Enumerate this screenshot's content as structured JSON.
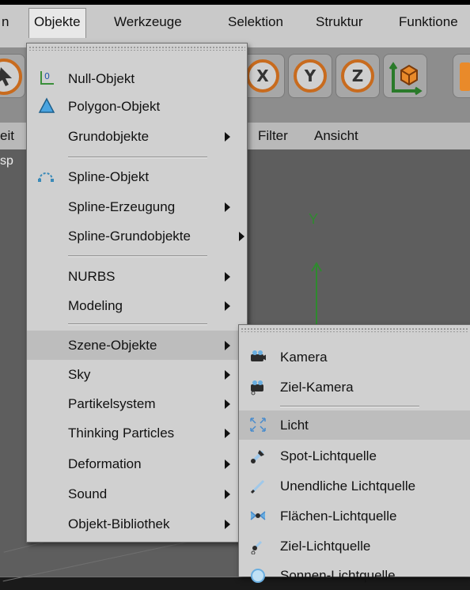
{
  "menubar": {
    "items": [
      "n",
      "Objekte",
      "Werkzeuge",
      "Selektion",
      "Struktur",
      "Funktione"
    ]
  },
  "toolbar": {
    "axis_x": "X",
    "axis_y": "Y",
    "axis_z": "Z"
  },
  "subbar": {
    "left_fragment": "eit",
    "filter": "Filter",
    "ansicht": "Ansicht"
  },
  "viewport": {
    "left_fragment": "sp",
    "axis_label": "Y"
  },
  "objekte_menu": {
    "items": [
      {
        "label": "Null-Objekt",
        "icon": "null-object-icon"
      },
      {
        "label": "Polygon-Objekt",
        "icon": "polygon-object-icon"
      },
      {
        "label": "Grundobjekte",
        "submenu": true
      },
      {
        "label": "Spline-Objekt",
        "icon": "spline-object-icon"
      },
      {
        "label": "Spline-Erzeugung",
        "submenu": true
      },
      {
        "label": "Spline-Grundobjekte",
        "submenu": true
      },
      {
        "label": "NURBS",
        "submenu": true
      },
      {
        "label": "Modeling",
        "submenu": true
      },
      {
        "label": "Szene-Objekte",
        "submenu": true,
        "highlighted": true
      },
      {
        "label": "Sky",
        "submenu": true
      },
      {
        "label": "Partikelsystem",
        "submenu": true
      },
      {
        "label": "Thinking Particles",
        "submenu": true
      },
      {
        "label": "Deformation",
        "submenu": true
      },
      {
        "label": "Sound",
        "submenu": true
      },
      {
        "label": "Objekt-Bibliothek",
        "submenu": true
      }
    ]
  },
  "szene_menu": {
    "items": [
      {
        "label": "Kamera",
        "icon": "camera-icon"
      },
      {
        "label": "Ziel-Kamera",
        "icon": "target-camera-icon"
      },
      {
        "label": "Licht",
        "icon": "light-icon",
        "highlighted": true
      },
      {
        "label": "Spot-Lichtquelle",
        "icon": "spotlight-icon"
      },
      {
        "label": "Unendliche Lichtquelle",
        "icon": "infinite-light-icon"
      },
      {
        "label": "Flächen-Lichtquelle",
        "icon": "area-light-icon"
      },
      {
        "label": "Ziel-Lichtquelle",
        "icon": "target-light-icon"
      },
      {
        "label": "Sonnen-Lichtquelle",
        "icon": "sun-light-icon"
      }
    ]
  },
  "colors": {
    "accent_orange": "#c86b1e",
    "axis_green": "#2f8a2f",
    "highlight": "#bdbdbd"
  }
}
